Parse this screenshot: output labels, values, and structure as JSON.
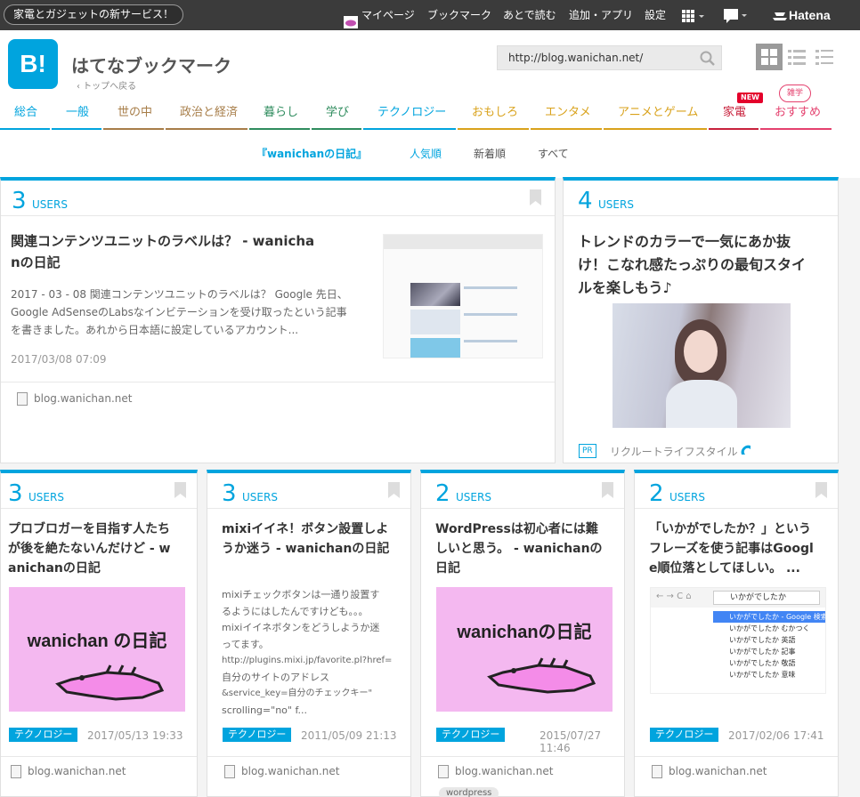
{
  "topbar": {
    "promo": "家電とガジェットの新サービス！",
    "mypage": "マイページ",
    "bookmark": "ブックマーク",
    "later": "あとで読む",
    "addapp": "追加・アプリ",
    "settings": "設定",
    "brand": "Hatena"
  },
  "header": {
    "logo": "B!",
    "title": "はてなブックマーク",
    "back": "‹ トップへ戻る",
    "search_value": "http://blog.wanichan.net/"
  },
  "categories": [
    {
      "label": "総合",
      "color": "#00a4de"
    },
    {
      "label": "一般",
      "color": "#00a4de"
    },
    {
      "label": "世の中",
      "color": "#a77d48"
    },
    {
      "label": "政治と経済",
      "color": "#a77d48"
    },
    {
      "label": "暮らし",
      "color": "#2f8c5e"
    },
    {
      "label": "学び",
      "color": "#2f8c5e"
    },
    {
      "label": "テクノロジー",
      "color": "#00a4de"
    },
    {
      "label": "おもしろ",
      "color": "#d9a21b"
    },
    {
      "label": "エンタメ",
      "color": "#d9a21b"
    },
    {
      "label": "アニメとゲーム",
      "color": "#d9a21b"
    },
    {
      "label": "家電",
      "color": "#c8213c"
    },
    {
      "label": "おすすめ",
      "color": "#e4416e"
    }
  ],
  "badges": {
    "new": "NEW",
    "zatsugaku": "雑学"
  },
  "subnav": {
    "site": "『wanichanの日記』",
    "popular": "人気順",
    "newest": "新着順",
    "all": "すべて"
  },
  "main_card": {
    "users": "3",
    "users_label": "USERS",
    "title_line1": "関連コンテンツユニットのラベルは？ - wanicha",
    "title_line2": "nの日記",
    "desc_line1": "2017 - 03 - 08 関連コンテンツユニットのラベルは？ Google 先日、",
    "desc_line2": "Google AdSenseのLabsなインビテーションを受け取ったという記事",
    "desc_line3": "を書きました。あれから日本語に設定しているアカウント...",
    "date": "2017/03/08 07:09",
    "site": "blog.wanichan.net"
  },
  "ad_card": {
    "users": "4",
    "users_label": "USERS",
    "title_line1": "トレンドのカラーで一気にあか抜",
    "title_line2": "け！こなれ感たっぷりの最旬スタイ",
    "title_line3": "ルを楽しもう♪",
    "pr": "PR",
    "sponsor": "リクルートライフスタイル"
  },
  "cards": [
    {
      "users": "3",
      "users_label": "USERS",
      "title": [
        "プロブロガーを目指す人たち",
        "が後を絶たないんだけど - w",
        "anichanの日記"
      ],
      "thumb_text": "wanichan の日記",
      "tag": "テクノロジー",
      "date": "2017/05/13 19:33",
      "site": "blog.wanichan.net"
    },
    {
      "users": "3",
      "users_label": "USERS",
      "title": [
        "mixiイイネ！ボタン設置しよ",
        "うか迷う - wanichanの日記"
      ],
      "desc": [
        "mixiチェックボタンは一通り設置す",
        "るようにはしたんですけども。。。",
        "mixiイイネボタンをどうしようか迷",
        "ってます。",
        "http://plugins.mixi.jp/favorite.pl?href=",
        "自分のサイトのアドレス",
        "&service_key=自分のチェックキー\"",
        "scrolling=\"no\" f..."
      ],
      "tag": "テクノロジー",
      "date": "2011/05/09 21:13",
      "site": "blog.wanichan.net"
    },
    {
      "users": "2",
      "users_label": "USERS",
      "title": [
        "WordPressは初心者には難",
        "しいと思う。 - wanichanの",
        "日記"
      ],
      "thumb_text": "wanichanの日記",
      "tag": "テクノロジー",
      "date": "2015/07/27 11:46",
      "site": "blog.wanichan.net",
      "extra_tag": "wordpress"
    },
    {
      "users": "2",
      "users_label": "USERS",
      "title": [
        "「いかがでしたか？」という",
        "フレーズを使う記事はGoogl",
        "e順位落としてほしい。 ..."
      ],
      "search_query": "いかがでしたか",
      "suggestions": [
        "いかがでしたか - Google 検索",
        "いかがでしたか むかつく",
        "いかがでしたか 英語",
        "いかがでしたか 記事",
        "いかがでしたか 敬語",
        "いかがでしたか 意味"
      ],
      "tag": "テクノロジー",
      "date": "2017/02/06 17:41",
      "site": "blog.wanichan.net"
    }
  ]
}
